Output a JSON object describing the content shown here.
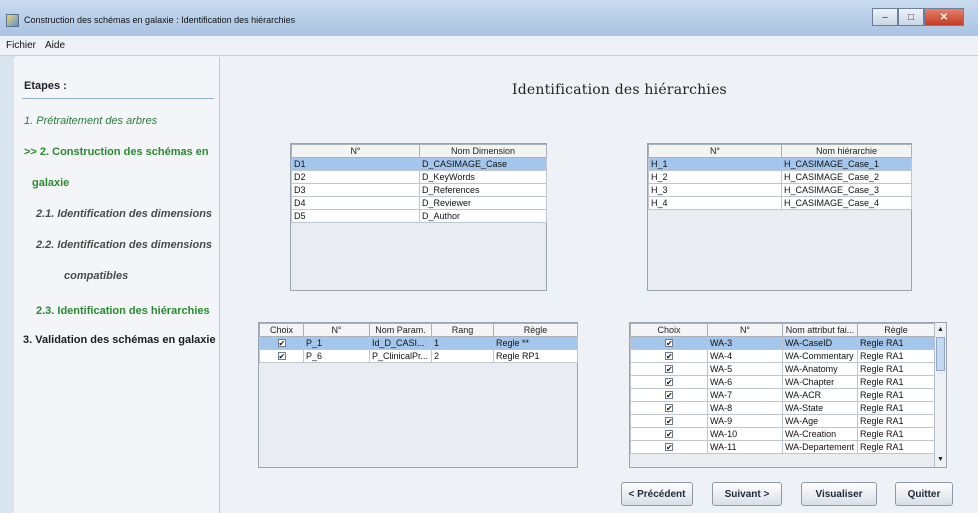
{
  "window": {
    "title": "Construction des schémas en galaxie : Identification des hiérarchies"
  },
  "menu": {
    "items": [
      "Fichier",
      "Aide"
    ]
  },
  "steps": {
    "title": "Etapes :",
    "items": [
      "1. Prétraitement des arbres",
      ">> 2. Construction des schémas en",
      "galaxie",
      "2.1. Identification des dimensions",
      "2.2. Identification des dimensions",
      "compatibles",
      "2.3. Identification des hiérarchies",
      "3. Validation des schémas en galaxie"
    ]
  },
  "page": {
    "title": "Identification des hiérarchies"
  },
  "dimensions": {
    "headers": [
      "N°",
      "Nom Dimension"
    ],
    "rows": [
      [
        "D1",
        "D_CASIMAGE_Case"
      ],
      [
        "D2",
        "D_KeyWords"
      ],
      [
        "D3",
        "D_References"
      ],
      [
        "D4",
        "D_Reviewer"
      ],
      [
        "D5",
        "D_Author"
      ]
    ]
  },
  "hierarchies": {
    "headers": [
      "N°",
      "Nom hiérarchie"
    ],
    "rows": [
      [
        "H_1",
        "H_CASIMAGE_Case_1"
      ],
      [
        "H_2",
        "H_CASIMAGE_Case_2"
      ],
      [
        "H_3",
        "H_CASIMAGE_Case_3"
      ],
      [
        "H_4",
        "H_CASIMAGE_Case_4"
      ]
    ]
  },
  "params": {
    "headers": [
      "Choix",
      "N°",
      "Nom Param.",
      "Rang",
      "Règle"
    ],
    "rows": [
      [
        "✔",
        "P_1",
        "Id_D_CASI...",
        "1",
        "Regle **"
      ],
      [
        "✔",
        "P_6",
        "P_ClinicalPr...",
        "2",
        "Regle RP1"
      ]
    ]
  },
  "attributes": {
    "headers": [
      "Choix",
      "N°",
      "Nom attribut fai...",
      "Règle"
    ],
    "rows": [
      [
        "✔",
        "WA-3",
        "WA-CaseID",
        "Regle RA1"
      ],
      [
        "✔",
        "WA-4",
        "WA-Commentary",
        "Regle RA1"
      ],
      [
        "✔",
        "WA-5",
        "WA-Anatomy",
        "Regle RA1"
      ],
      [
        "✔",
        "WA-6",
        "WA-Chapter",
        "Regle RA1"
      ],
      [
        "✔",
        "WA-7",
        "WA-ACR",
        "Regle RA1"
      ],
      [
        "✔",
        "WA-8",
        "WA-State",
        "Regle RA1"
      ],
      [
        "✔",
        "WA-9",
        "WA-Age",
        "Regle RA1"
      ],
      [
        "✔",
        "WA-10",
        "WA-Creation",
        "Regle RA1"
      ],
      [
        "✔",
        "WA-11",
        "WA-Departement",
        "Regle RA1"
      ]
    ]
  },
  "buttons": {
    "previous": "< Précédent",
    "next": "Suivant >",
    "visualize": "Visualiser",
    "quit": "Quitter"
  }
}
